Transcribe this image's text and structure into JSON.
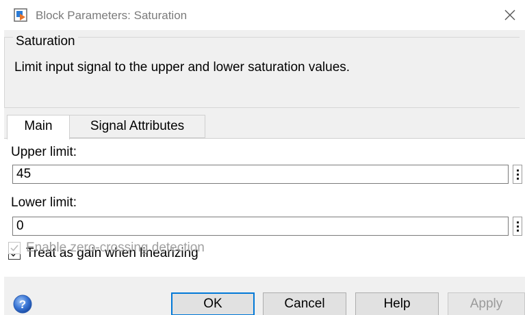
{
  "window": {
    "title": "Block Parameters: Saturation",
    "icon": "simulink-block-icon",
    "close_icon": "close-icon"
  },
  "description_group": {
    "title": "Saturation",
    "text": "Limit input signal to the upper and lower saturation values."
  },
  "tabs": [
    {
      "label": "Main",
      "active": true
    },
    {
      "label": "Signal Attributes",
      "active": false
    }
  ],
  "fields": {
    "upper_limit": {
      "label": "Upper limit:",
      "value": "45"
    },
    "lower_limit": {
      "label": "Lower limit:",
      "value": "0"
    }
  },
  "checkboxes": {
    "treat_as_gain": {
      "label": "Treat as gain when linearizing",
      "checked": true,
      "enabled": true
    },
    "zero_crossing": {
      "label": "Enable zero-crossing detection",
      "checked": true,
      "enabled": false
    }
  },
  "buttons": {
    "ok": "OK",
    "cancel": "Cancel",
    "help": "Help",
    "apply": "Apply"
  },
  "colors": {
    "panel_bg": "#f0f0f0",
    "focus_border": "#0078d7",
    "disabled_text": "#a0a0a0"
  }
}
